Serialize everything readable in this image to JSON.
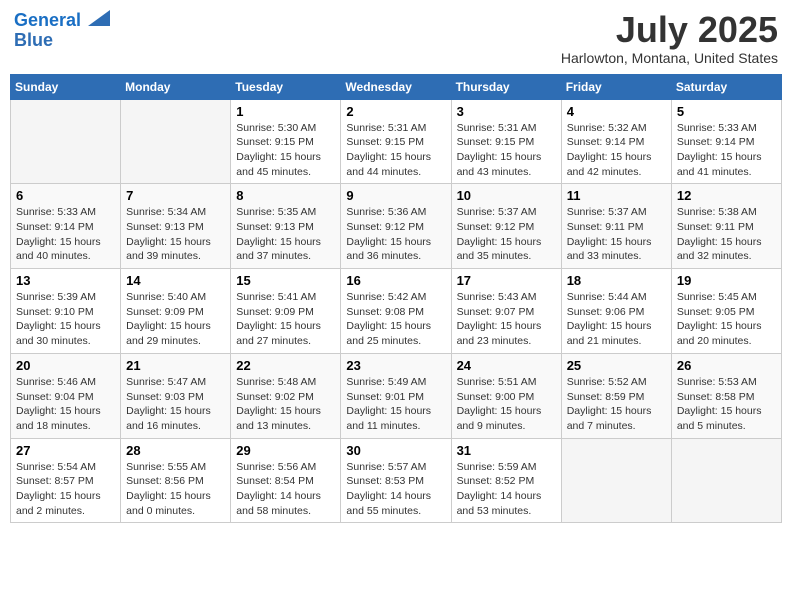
{
  "header": {
    "logo_line1": "General",
    "logo_line2": "Blue",
    "month": "July 2025",
    "location": "Harlowton, Montana, United States"
  },
  "weekdays": [
    "Sunday",
    "Monday",
    "Tuesday",
    "Wednesday",
    "Thursday",
    "Friday",
    "Saturday"
  ],
  "weeks": [
    [
      {
        "day": "",
        "empty": true
      },
      {
        "day": "",
        "empty": true
      },
      {
        "day": "1",
        "sunrise": "Sunrise: 5:30 AM",
        "sunset": "Sunset: 9:15 PM",
        "daylight": "Daylight: 15 hours and 45 minutes."
      },
      {
        "day": "2",
        "sunrise": "Sunrise: 5:31 AM",
        "sunset": "Sunset: 9:15 PM",
        "daylight": "Daylight: 15 hours and 44 minutes."
      },
      {
        "day": "3",
        "sunrise": "Sunrise: 5:31 AM",
        "sunset": "Sunset: 9:15 PM",
        "daylight": "Daylight: 15 hours and 43 minutes."
      },
      {
        "day": "4",
        "sunrise": "Sunrise: 5:32 AM",
        "sunset": "Sunset: 9:14 PM",
        "daylight": "Daylight: 15 hours and 42 minutes."
      },
      {
        "day": "5",
        "sunrise": "Sunrise: 5:33 AM",
        "sunset": "Sunset: 9:14 PM",
        "daylight": "Daylight: 15 hours and 41 minutes."
      }
    ],
    [
      {
        "day": "6",
        "sunrise": "Sunrise: 5:33 AM",
        "sunset": "Sunset: 9:14 PM",
        "daylight": "Daylight: 15 hours and 40 minutes."
      },
      {
        "day": "7",
        "sunrise": "Sunrise: 5:34 AM",
        "sunset": "Sunset: 9:13 PM",
        "daylight": "Daylight: 15 hours and 39 minutes."
      },
      {
        "day": "8",
        "sunrise": "Sunrise: 5:35 AM",
        "sunset": "Sunset: 9:13 PM",
        "daylight": "Daylight: 15 hours and 37 minutes."
      },
      {
        "day": "9",
        "sunrise": "Sunrise: 5:36 AM",
        "sunset": "Sunset: 9:12 PM",
        "daylight": "Daylight: 15 hours and 36 minutes."
      },
      {
        "day": "10",
        "sunrise": "Sunrise: 5:37 AM",
        "sunset": "Sunset: 9:12 PM",
        "daylight": "Daylight: 15 hours and 35 minutes."
      },
      {
        "day": "11",
        "sunrise": "Sunrise: 5:37 AM",
        "sunset": "Sunset: 9:11 PM",
        "daylight": "Daylight: 15 hours and 33 minutes."
      },
      {
        "day": "12",
        "sunrise": "Sunrise: 5:38 AM",
        "sunset": "Sunset: 9:11 PM",
        "daylight": "Daylight: 15 hours and 32 minutes."
      }
    ],
    [
      {
        "day": "13",
        "sunrise": "Sunrise: 5:39 AM",
        "sunset": "Sunset: 9:10 PM",
        "daylight": "Daylight: 15 hours and 30 minutes."
      },
      {
        "day": "14",
        "sunrise": "Sunrise: 5:40 AM",
        "sunset": "Sunset: 9:09 PM",
        "daylight": "Daylight: 15 hours and 29 minutes."
      },
      {
        "day": "15",
        "sunrise": "Sunrise: 5:41 AM",
        "sunset": "Sunset: 9:09 PM",
        "daylight": "Daylight: 15 hours and 27 minutes."
      },
      {
        "day": "16",
        "sunrise": "Sunrise: 5:42 AM",
        "sunset": "Sunset: 9:08 PM",
        "daylight": "Daylight: 15 hours and 25 minutes."
      },
      {
        "day": "17",
        "sunrise": "Sunrise: 5:43 AM",
        "sunset": "Sunset: 9:07 PM",
        "daylight": "Daylight: 15 hours and 23 minutes."
      },
      {
        "day": "18",
        "sunrise": "Sunrise: 5:44 AM",
        "sunset": "Sunset: 9:06 PM",
        "daylight": "Daylight: 15 hours and 21 minutes."
      },
      {
        "day": "19",
        "sunrise": "Sunrise: 5:45 AM",
        "sunset": "Sunset: 9:05 PM",
        "daylight": "Daylight: 15 hours and 20 minutes."
      }
    ],
    [
      {
        "day": "20",
        "sunrise": "Sunrise: 5:46 AM",
        "sunset": "Sunset: 9:04 PM",
        "daylight": "Daylight: 15 hours and 18 minutes."
      },
      {
        "day": "21",
        "sunrise": "Sunrise: 5:47 AM",
        "sunset": "Sunset: 9:03 PM",
        "daylight": "Daylight: 15 hours and 16 minutes."
      },
      {
        "day": "22",
        "sunrise": "Sunrise: 5:48 AM",
        "sunset": "Sunset: 9:02 PM",
        "daylight": "Daylight: 15 hours and 13 minutes."
      },
      {
        "day": "23",
        "sunrise": "Sunrise: 5:49 AM",
        "sunset": "Sunset: 9:01 PM",
        "daylight": "Daylight: 15 hours and 11 minutes."
      },
      {
        "day": "24",
        "sunrise": "Sunrise: 5:51 AM",
        "sunset": "Sunset: 9:00 PM",
        "daylight": "Daylight: 15 hours and 9 minutes."
      },
      {
        "day": "25",
        "sunrise": "Sunrise: 5:52 AM",
        "sunset": "Sunset: 8:59 PM",
        "daylight": "Daylight: 15 hours and 7 minutes."
      },
      {
        "day": "26",
        "sunrise": "Sunrise: 5:53 AM",
        "sunset": "Sunset: 8:58 PM",
        "daylight": "Daylight: 15 hours and 5 minutes."
      }
    ],
    [
      {
        "day": "27",
        "sunrise": "Sunrise: 5:54 AM",
        "sunset": "Sunset: 8:57 PM",
        "daylight": "Daylight: 15 hours and 2 minutes."
      },
      {
        "day": "28",
        "sunrise": "Sunrise: 5:55 AM",
        "sunset": "Sunset: 8:56 PM",
        "daylight": "Daylight: 15 hours and 0 minutes."
      },
      {
        "day": "29",
        "sunrise": "Sunrise: 5:56 AM",
        "sunset": "Sunset: 8:54 PM",
        "daylight": "Daylight: 14 hours and 58 minutes."
      },
      {
        "day": "30",
        "sunrise": "Sunrise: 5:57 AM",
        "sunset": "Sunset: 8:53 PM",
        "daylight": "Daylight: 14 hours and 55 minutes."
      },
      {
        "day": "31",
        "sunrise": "Sunrise: 5:59 AM",
        "sunset": "Sunset: 8:52 PM",
        "daylight": "Daylight: 14 hours and 53 minutes."
      },
      {
        "day": "",
        "empty": true
      },
      {
        "day": "",
        "empty": true
      }
    ]
  ]
}
